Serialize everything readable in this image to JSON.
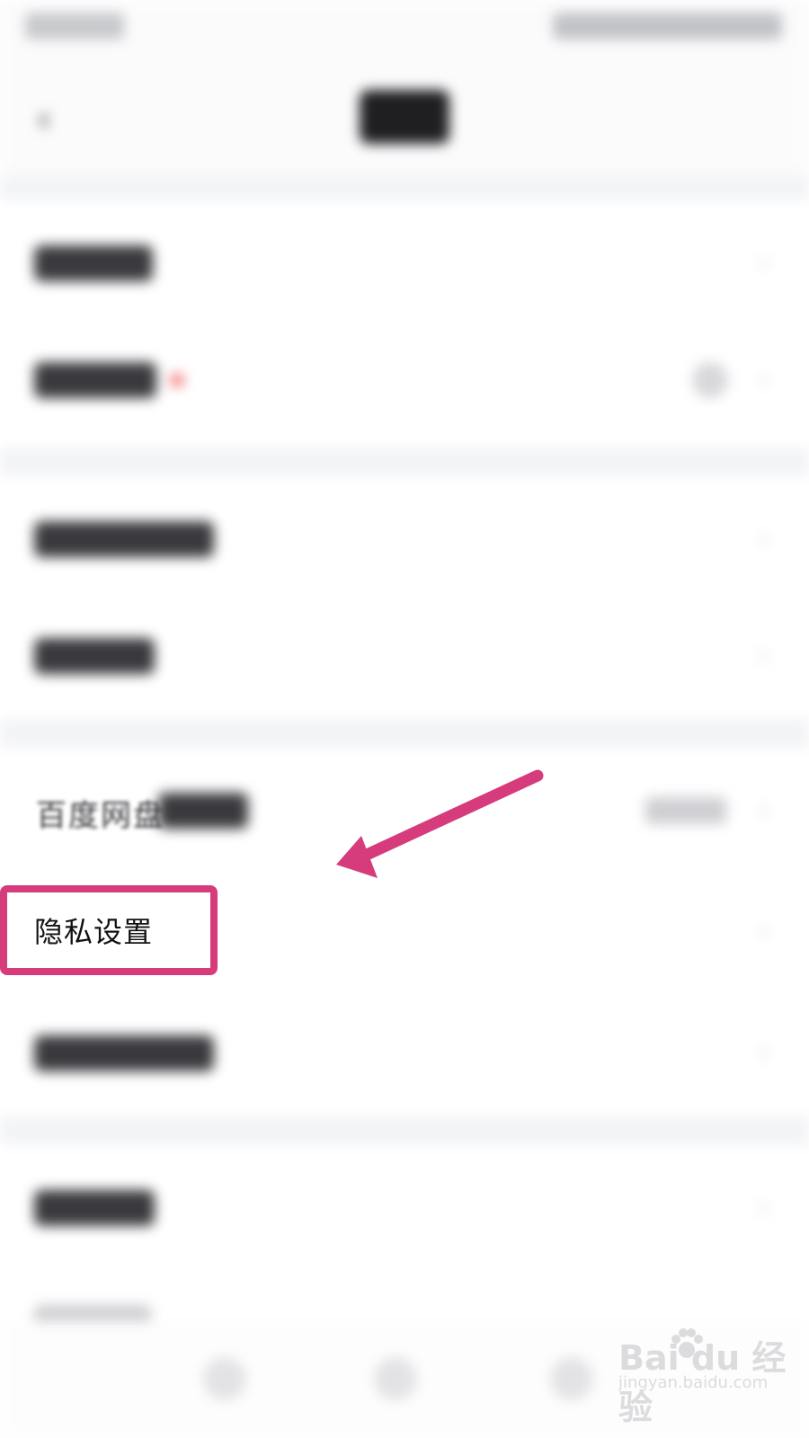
{
  "status_bar": {},
  "nav": {
    "back_icon": "chevron-left-icon"
  },
  "rows": {
    "partial_item_label": "百度网盘",
    "privacy_settings_label": "隐私设置"
  },
  "annotation": {
    "highlight_color": "#d63c7c",
    "arrow_color": "#d63c7c"
  },
  "watermark": {
    "brand": "Bai du 经验",
    "url": "jingyan.baidu.com"
  }
}
